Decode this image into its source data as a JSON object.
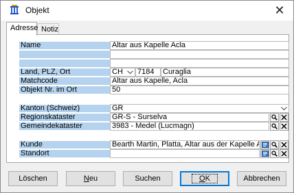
{
  "window": {
    "title": "Objekt",
    "close_glyph": "✕"
  },
  "tabs": [
    {
      "label": "Adresse",
      "active": true
    },
    {
      "label": "Notiz",
      "active": false
    }
  ],
  "fields": {
    "name_label": "Name",
    "name_value": "Altar aus Kapelle Acla",
    "land_label": "Land, PLZ, Ort",
    "land_value": "CH",
    "plz_value": "7184",
    "ort_value": "Curaglia",
    "matchcode_label": "Matchcode",
    "matchcode_value": "Altar aus Kapelle, Acla",
    "objekt_nr_label": "Objekt Nr. im Ort",
    "objekt_nr_value": "50",
    "kanton_label": "Kanton (Schweiz)",
    "kanton_value": "GR",
    "regionskataster_label": "Regionskataster",
    "regionskataster_value": "GR-S - Surselva",
    "gemeindekataster_label": "Gemeindekataster",
    "gemeindekataster_value": "3983 - Medel (Lucmagn)",
    "kunde_label": "Kunde",
    "kunde_value": "Bearth Martin, Platta, Altar aus der Kapelle Acla",
    "standort_label": "Standort",
    "standort_value": ""
  },
  "buttons": {
    "loeschen": "Löschen",
    "neu_underlined": "N",
    "neu_rest": "eu",
    "suchen": "Suchen",
    "ok_underlined": "O",
    "ok_rest": "K",
    "abbrechen": "Abbrechen"
  },
  "icons": {
    "app": "museum-icon",
    "search": "magnifier-icon",
    "clear": "x-icon",
    "lookup": "address-book-icon",
    "dropdown": "chevron-down-icon"
  },
  "colors": {
    "label_bg": "#b5d3ee",
    "default_button_border": "#0078d7"
  }
}
